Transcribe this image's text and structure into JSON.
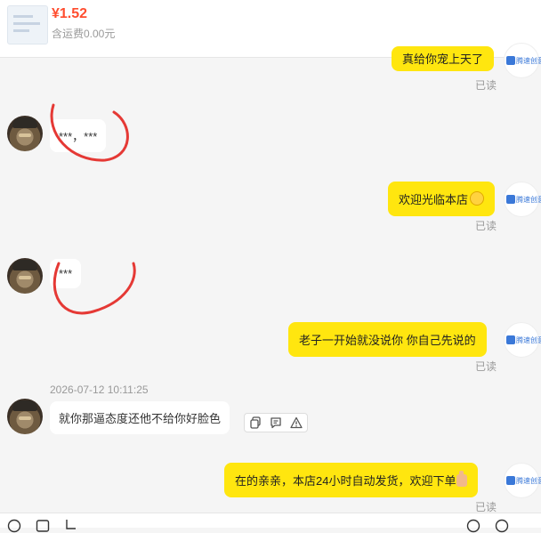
{
  "header": {
    "price": "¥1.52",
    "shipping": "含运费0.00元"
  },
  "messages": {
    "m1_text": "真给你宠上天了",
    "m1_read": "已读",
    "m2_text": "***，***",
    "m3_text": "欢迎光临本店",
    "m3_emoji": "smile-emoji",
    "m3_read": "已读",
    "m4_text": "***",
    "m5_text": "老子一开始就没说你 你自己先说的",
    "m5_read": "已读",
    "timestamp": "2026-07-12 10:11:25",
    "m6_text": "就你那逼态度还他不给你好脸色",
    "m7_text": "在的亲亲，本店24小时自动发货，欢迎下单",
    "m7_emoji": "thumbs-up-emoji",
    "m7_read": "已读"
  },
  "shop": {
    "avatar_label": "腾速创意"
  },
  "colors": {
    "price": "#ff4d2f",
    "bubble_out": "#ffe60f",
    "bubble_in": "#ffffff",
    "annotation": "#e53935"
  },
  "icons": {
    "message_actions": [
      "copy-icon",
      "quote-icon",
      "report-icon"
    ],
    "toolbar": [
      "emoji-icon",
      "image-icon",
      "scissors-icon",
      "clock-icon",
      "smile-icon"
    ]
  }
}
